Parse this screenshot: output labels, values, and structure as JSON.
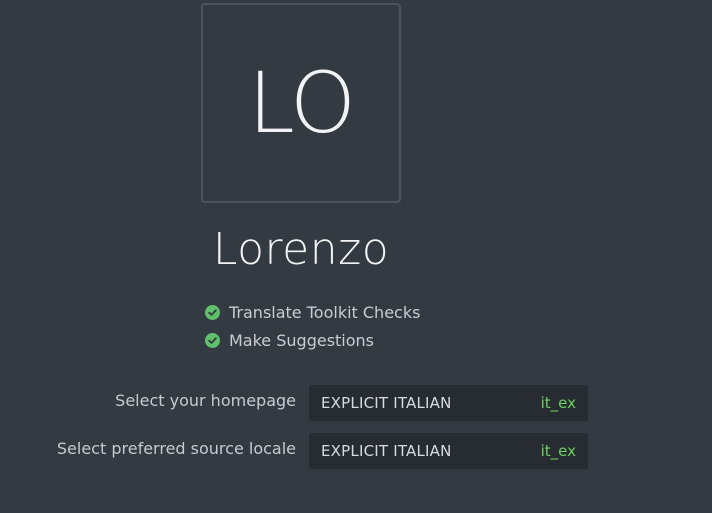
{
  "profile": {
    "initials": "LO",
    "name": "Lorenzo"
  },
  "permissions": [
    {
      "label": "Translate Toolkit Checks"
    },
    {
      "label": "Make Suggestions"
    }
  ],
  "settings": {
    "homepage": {
      "label": "Select your homepage",
      "value_name": "EXPLICIT ITALIAN",
      "value_code": "it_ex"
    },
    "source_locale": {
      "label": "Select preferred source locale",
      "value_name": "EXPLICIT ITALIAN",
      "value_code": "it_ex"
    }
  },
  "colors": {
    "background": "#343a41",
    "check": "#5fbf6a",
    "locale_code": "#6ccf5f",
    "select_bg": "#272c32"
  },
  "icons": {
    "permission": "check-circle-icon"
  }
}
